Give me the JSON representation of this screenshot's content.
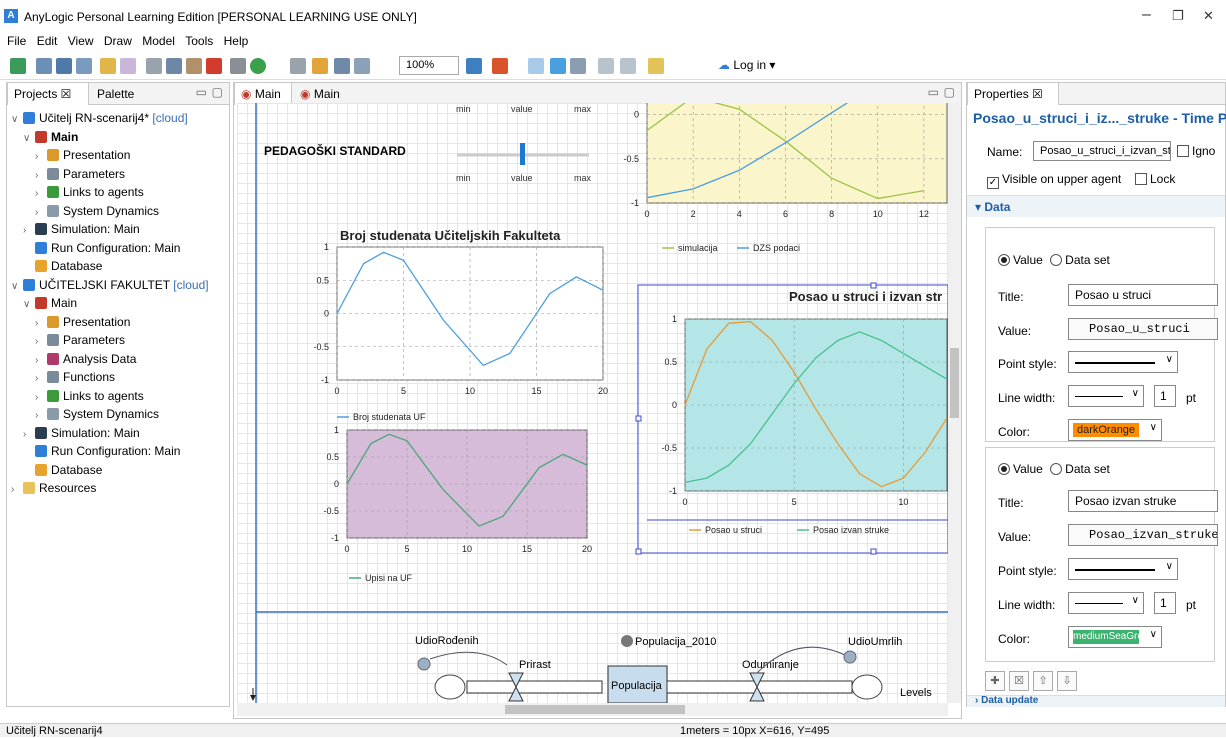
{
  "window": {
    "title": "AnyLogic Personal Learning Edition [PERSONAL LEARNING USE ONLY]",
    "controls": [
      "–",
      "❐",
      "✕"
    ]
  },
  "menu": [
    "File",
    "Edit",
    "View",
    "Draw",
    "Model",
    "Tools",
    "Help"
  ],
  "toolbar": {
    "zoom": "100%",
    "login_label": "Log in"
  },
  "left_panel": {
    "tabs": [
      {
        "label": "Projects ☒"
      },
      {
        "label": "Palette"
      }
    ],
    "tree": [
      {
        "label": "Učitelj RN-scenarij4*",
        "suffix": "[cloud]",
        "level": 0,
        "arrow": "v",
        "icon": "anylogic-model-icon",
        "color": "#2f7fd8"
      },
      {
        "label": "Main",
        "level": 1,
        "arrow": "v",
        "bold": true,
        "icon": "agent-icon",
        "color": "#c0392b"
      },
      {
        "label": "Presentation",
        "level": 2,
        "arrow": ">",
        "icon": "presentation-icon",
        "color": "#d99a2b"
      },
      {
        "label": "Parameters",
        "level": 2,
        "arrow": ">",
        "icon": "parameters-icon",
        "color": "#7c8b99"
      },
      {
        "label": "Links to agents",
        "level": 2,
        "arrow": ">",
        "icon": "links-icon",
        "color": "#3b9b3b"
      },
      {
        "label": "System Dynamics",
        "level": 2,
        "arrow": ">",
        "icon": "system-dynamics-icon",
        "color": "#8a9aa8"
      },
      {
        "label": "Simulation: Main",
        "level": 1,
        "arrow": ">",
        "icon": "simulation-icon",
        "color": "#2b3e50"
      },
      {
        "label": "Run Configuration: Main",
        "level": 1,
        "arrow": "",
        "icon": "run-config-icon",
        "color": "#2f7fd8"
      },
      {
        "label": "Database",
        "level": 1,
        "arrow": "",
        "icon": "database-icon",
        "color": "#e8a32b"
      },
      {
        "label": "UČITELJSKI FAKULTET",
        "suffix": "[cloud]",
        "level": 0,
        "arrow": "v",
        "icon": "anylogic-model-icon",
        "color": "#2f7fd8"
      },
      {
        "label": "Main",
        "level": 1,
        "arrow": "v",
        "icon": "agent-icon",
        "color": "#c0392b"
      },
      {
        "label": "Presentation",
        "level": 2,
        "arrow": ">",
        "icon": "presentation-icon",
        "color": "#d99a2b"
      },
      {
        "label": "Parameters",
        "level": 2,
        "arrow": ">",
        "icon": "parameters-icon",
        "color": "#7c8b99"
      },
      {
        "label": "Analysis Data",
        "level": 2,
        "arrow": ">",
        "icon": "analysis-data-icon",
        "color": "#b03a6b"
      },
      {
        "label": "Functions",
        "level": 2,
        "arrow": ">",
        "icon": "functions-icon",
        "color": "#7c8b99"
      },
      {
        "label": "Links to agents",
        "level": 2,
        "arrow": ">",
        "icon": "links-icon",
        "color": "#3b9b3b"
      },
      {
        "label": "System Dynamics",
        "level": 2,
        "arrow": ">",
        "icon": "system-dynamics-icon",
        "color": "#8a9aa8"
      },
      {
        "label": "Simulation: Main",
        "level": 1,
        "arrow": ">",
        "icon": "simulation-icon",
        "color": "#2b3e50"
      },
      {
        "label": "Run Configuration: Main",
        "level": 1,
        "arrow": "",
        "icon": "run-config-icon",
        "color": "#2f7fd8"
      },
      {
        "label": "Database",
        "level": 1,
        "arrow": "",
        "icon": "database-icon",
        "color": "#e8a32b"
      },
      {
        "label": "Resources",
        "level": 0,
        "arrow": ">",
        "icon": "folder-icon",
        "color": "#e8c25a"
      }
    ]
  },
  "editor": {
    "tabs": [
      {
        "label": "Main ☒"
      },
      {
        "label": "Main"
      }
    ],
    "heading": "PEDAGOŠKI STANDARD",
    "slider_top": {
      "min": "min",
      "value": "value",
      "max": "max"
    },
    "slider": {
      "min": "min",
      "value": "value",
      "max": "max"
    },
    "levels_label": "Levels",
    "sd": {
      "udio_rodenih": "UdioRođenih",
      "prirast": "Prirast",
      "populacija_2010": "Populacija_2010",
      "populacija": "Populacija",
      "odumiranje": "Odumiranje",
      "udio_umrlih": "UdioUmrlih"
    }
  },
  "chart_data": [
    {
      "type": "line",
      "title": "",
      "x": [
        0,
        2,
        4,
        6,
        8,
        10,
        12
      ],
      "xticks": [
        "0",
        "2",
        "4",
        "6",
        "8",
        "10",
        "12"
      ],
      "yticks": [
        "0",
        "-0.5",
        "-1"
      ],
      "ylim": [
        -1,
        0.3
      ],
      "background": "#fbf5cc",
      "series": [
        {
          "name": "simulacija",
          "color": "#9bc445",
          "fn": "sin",
          "values": [
            -0.18,
            0.2,
            0.06,
            -0.3,
            -0.72,
            -0.95,
            -0.86
          ]
        },
        {
          "name": "DZS podaci",
          "color": "#4a9fe0",
          "fn": "cos",
          "values": [
            -0.94,
            -0.84,
            -0.63,
            -0.32,
            0.02,
            0.35,
            0.66
          ]
        }
      ]
    },
    {
      "type": "line",
      "title": "Broj studenata Učiteljskih Fakulteta",
      "xlim": [
        0,
        20
      ],
      "ylim": [
        -1,
        1
      ],
      "xticks": [
        "0",
        "5",
        "10",
        "15",
        "20"
      ],
      "yticks": [
        "1",
        "0.5",
        "0",
        "-0.5",
        "-1"
      ],
      "background": "#ffffff",
      "series": [
        {
          "name": "Broj studenata UF",
          "color": "#4a9fe0",
          "x": [
            0,
            2,
            3.5,
            5,
            8,
            11,
            13,
            16,
            18,
            20
          ],
          "values": [
            0,
            0.75,
            0.92,
            0.8,
            -0.1,
            -0.78,
            -0.6,
            0.3,
            0.55,
            0.35
          ]
        }
      ]
    },
    {
      "type": "line",
      "title": "",
      "xlim": [
        0,
        20
      ],
      "ylim": [
        -1,
        1
      ],
      "xticks": [
        "0",
        "5",
        "10",
        "15",
        "20"
      ],
      "yticks": [
        "1",
        "0.5",
        "0",
        "-0.5",
        "-1"
      ],
      "background": "#d6bcd9",
      "series": [
        {
          "name": "Upisi na UF",
          "color": "#4ba67a",
          "x": [
            0,
            2,
            3.5,
            5,
            8,
            11,
            13,
            16,
            18,
            20
          ],
          "values": [
            0,
            0.75,
            0.92,
            0.8,
            -0.1,
            -0.78,
            -0.6,
            0.3,
            0.55,
            0.35
          ]
        }
      ]
    },
    {
      "type": "line",
      "title": "Posao u struci i izvan str",
      "xlim": [
        0,
        12
      ],
      "ylim": [
        -1,
        1
      ],
      "xticks": [
        "0",
        "5",
        "10"
      ],
      "yticks": [
        "1",
        "0.5",
        "0",
        "-0.5",
        "-1"
      ],
      "background": "#b4e6e8",
      "series": [
        {
          "name": "Posao u struci",
          "color": "#e89a35",
          "x": [
            0,
            1,
            2,
            3,
            4,
            5,
            6,
            7,
            8,
            9,
            10,
            11,
            12
          ],
          "values": [
            0.0,
            0.65,
            0.95,
            0.97,
            0.75,
            0.38,
            -0.05,
            -0.45,
            -0.8,
            -0.95,
            -0.85,
            -0.55,
            -0.15
          ]
        },
        {
          "name": "Posao izvan struke",
          "color": "#4bc08c",
          "x": [
            0,
            1,
            2,
            3,
            4,
            5,
            6,
            7,
            8,
            9,
            10,
            11,
            12
          ],
          "values": [
            -0.9,
            -0.85,
            -0.7,
            -0.45,
            -0.1,
            0.25,
            0.55,
            0.75,
            0.85,
            0.75,
            0.6,
            0.45,
            0.3
          ]
        }
      ]
    }
  ],
  "properties": {
    "tab_label": "Properties ☒",
    "title": "Posao_u_struci_i_iz..._struke - Time Plot",
    "name_label": "Name:",
    "name_value": "Posao_u_struci_i_izvan_stru",
    "ignore_label": "Igno",
    "visible_label": "Visible on upper agent",
    "lock_label": "Lock",
    "data_section": "Data",
    "value_option": "Value",
    "dataset_option": "Data set",
    "title_label": "Title:",
    "value_label": "Value:",
    "point_style_label": "Point style:",
    "line_width_label": "Line width:",
    "color_label": "Color:",
    "pt_label": "pt",
    "item1": {
      "title": "Posao u struci",
      "value": "Posao_u_struci",
      "line_width": "1",
      "color_name": "darkOrange",
      "color": "#ff8c00"
    },
    "item2": {
      "title": "Posao izvan struke",
      "value": "Posao_izvan_struke",
      "line_width": "1",
      "color_name": "mediumSeaGreen",
      "color": "#3cb371"
    },
    "next_section": "Data update"
  },
  "statusbar": {
    "project": "Učitelj RN-scenarij4",
    "coords": "1meters = 10px  X=616, Y=495"
  }
}
